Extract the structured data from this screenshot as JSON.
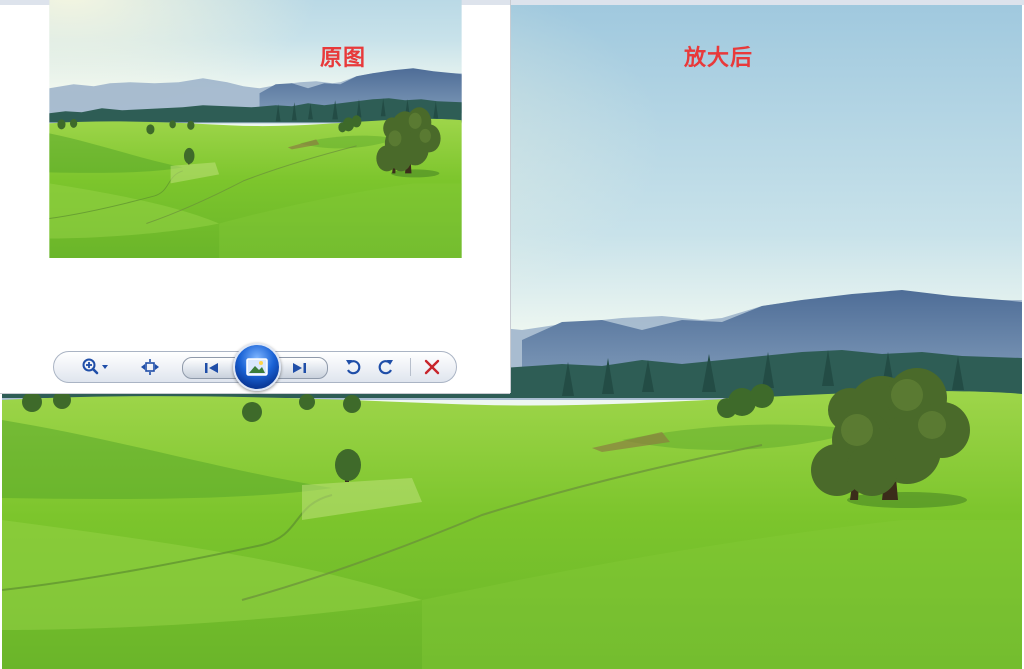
{
  "captions": {
    "original": "原图",
    "enlarged": "放大后"
  },
  "toolbar": {
    "zoom": {
      "icon": "zoom-in-icon"
    },
    "actual_size": {
      "icon": "actual-size-icon"
    },
    "previous": {
      "icon": "previous-icon"
    },
    "slideshow": {
      "icon": "slideshow-icon"
    },
    "next": {
      "icon": "next-icon"
    },
    "rotate_left": {
      "icon": "rotate-counterclockwise-icon"
    },
    "rotate_right": {
      "icon": "rotate-clockwise-icon"
    },
    "delete": {
      "icon": "delete-icon"
    }
  },
  "colors": {
    "caption": "#e8393a",
    "icon_blue": "#1f4ea8",
    "delete_red": "#c8252b",
    "sky_top": "#a5cce0",
    "sky_haze": "#eef7f1",
    "mountain": "#5878a2",
    "forest": "#2d5e55",
    "grass": "#7dc52e",
    "tree": "#4a6a2a"
  }
}
